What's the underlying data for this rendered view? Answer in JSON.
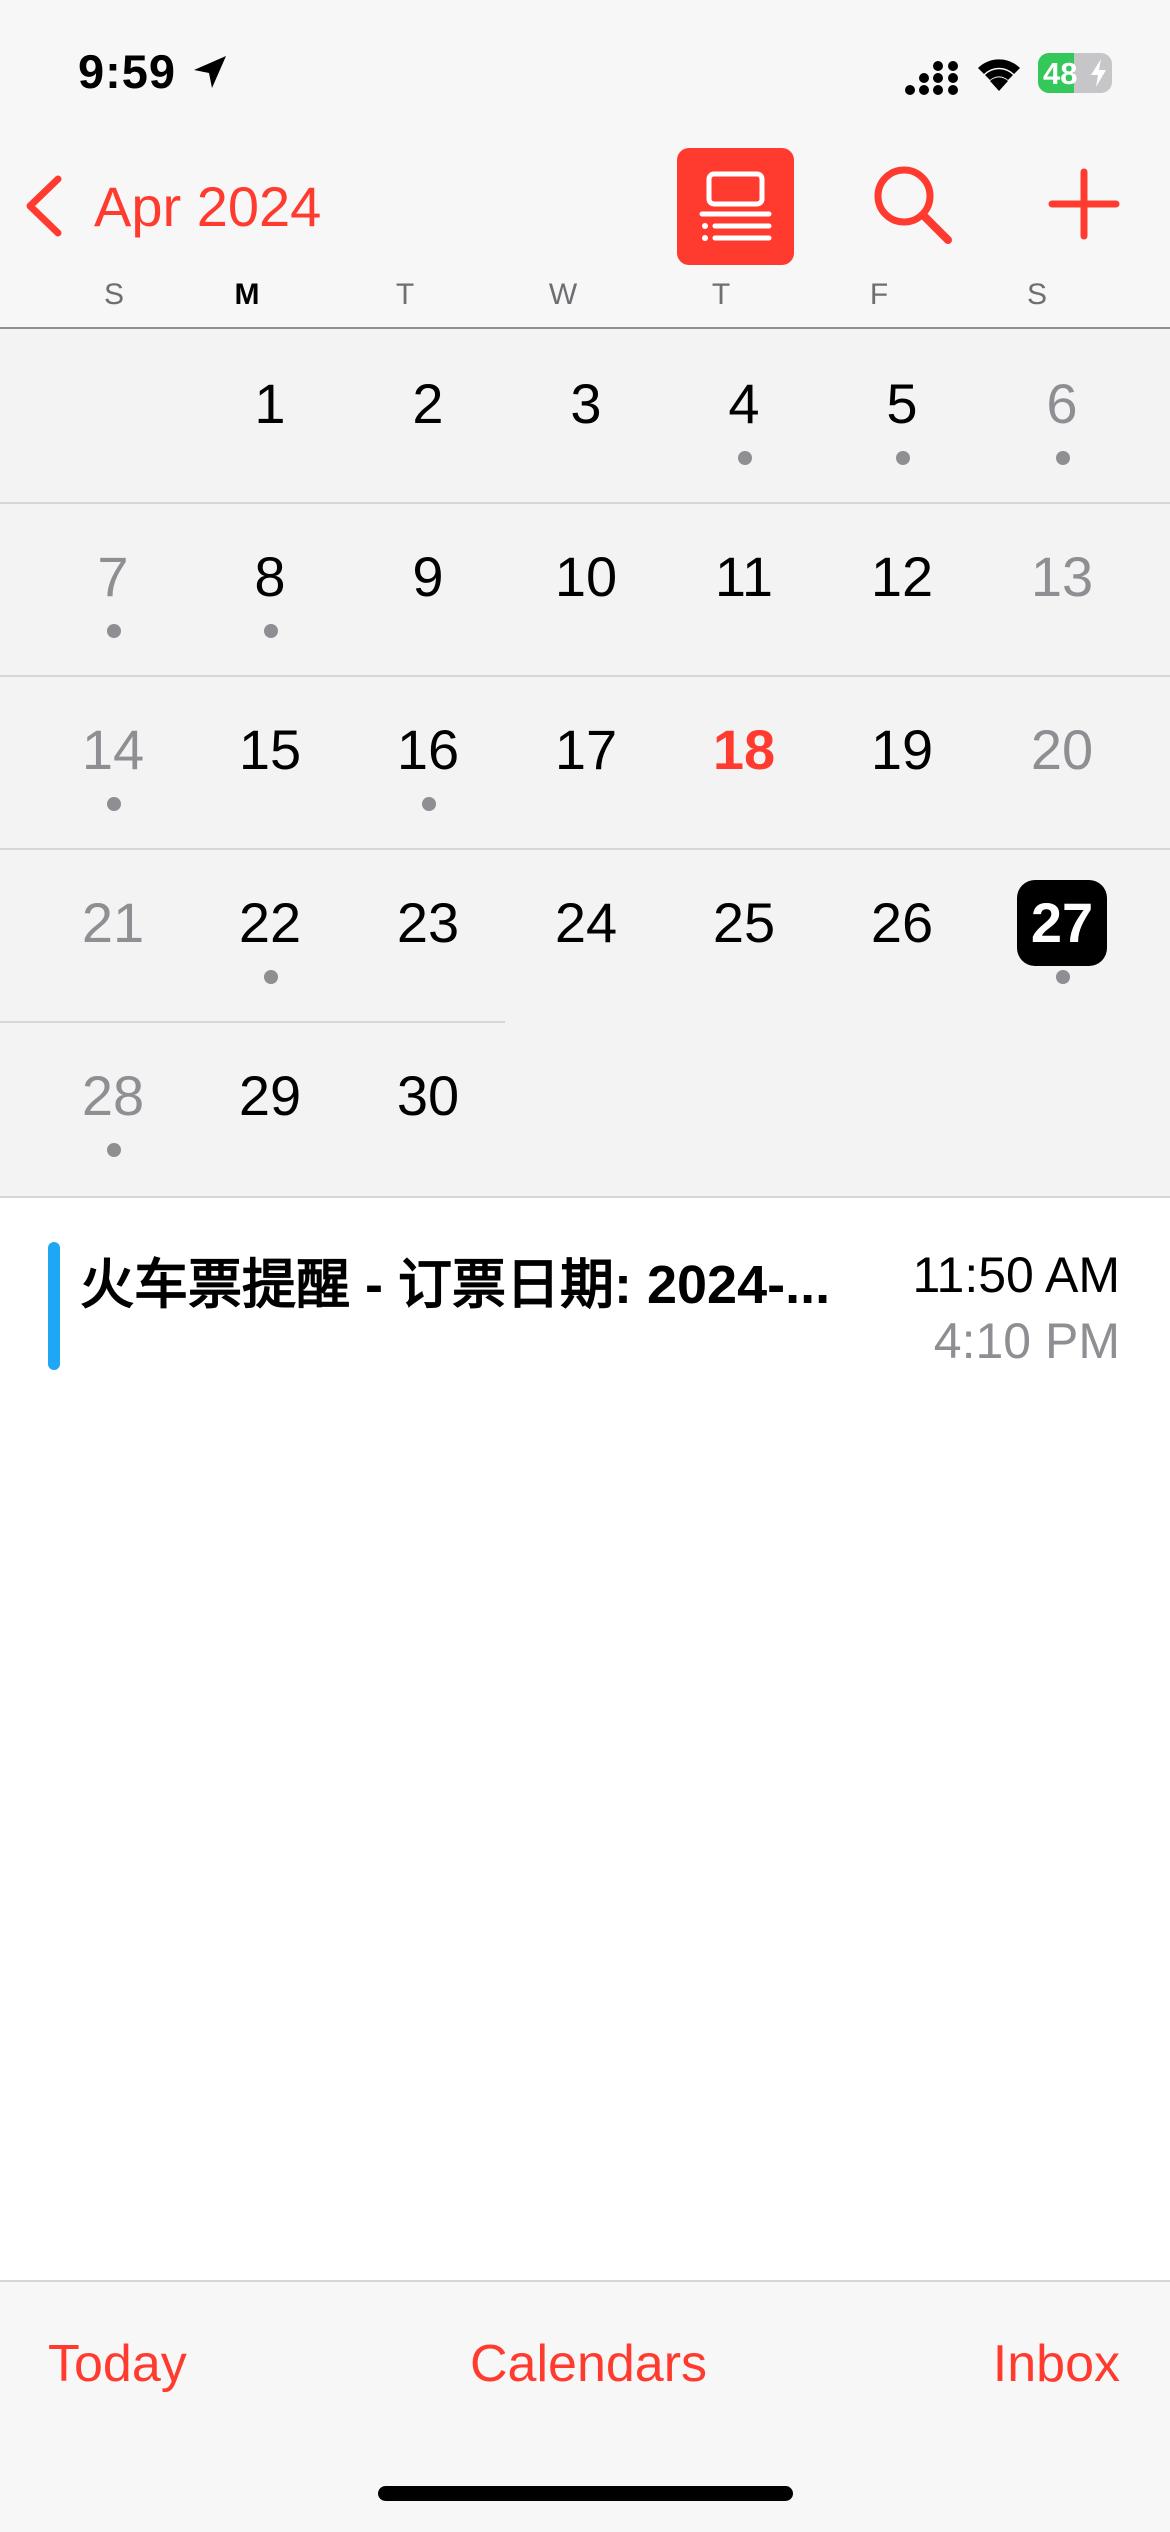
{
  "status_bar": {
    "time": "9:59",
    "battery": "48",
    "battery_level": 0.48,
    "icons": [
      "location-arrow-icon",
      "cellular-signal-icon",
      "wifi-icon",
      "battery-icon",
      "charging-bolt-icon"
    ]
  },
  "header": {
    "back_label": "Apr 2024",
    "icons": [
      "chevron-left-icon",
      "list-view-icon",
      "search-icon",
      "plus-icon"
    ],
    "accent_color": "#ff3b30"
  },
  "weekdays": [
    "S",
    "M",
    "T",
    "W",
    "T",
    "F",
    "S"
  ],
  "calendar": {
    "month": "Apr 2024",
    "today": "18",
    "selected": "27",
    "weeks": [
      [
        {
          "n": "",
          "dot": false
        },
        {
          "n": "1",
          "dot": false
        },
        {
          "n": "2",
          "dot": false
        },
        {
          "n": "3",
          "dot": false
        },
        {
          "n": "4",
          "dot": true
        },
        {
          "n": "5",
          "dot": true
        },
        {
          "n": "6",
          "dot": true
        }
      ],
      [
        {
          "n": "7",
          "dot": true
        },
        {
          "n": "8",
          "dot": true
        },
        {
          "n": "9",
          "dot": false
        },
        {
          "n": "10",
          "dot": false
        },
        {
          "n": "11",
          "dot": false
        },
        {
          "n": "12",
          "dot": false
        },
        {
          "n": "13",
          "dot": false
        }
      ],
      [
        {
          "n": "14",
          "dot": true
        },
        {
          "n": "15",
          "dot": false
        },
        {
          "n": "16",
          "dot": true
        },
        {
          "n": "17",
          "dot": false
        },
        {
          "n": "18",
          "dot": false
        },
        {
          "n": "19",
          "dot": false
        },
        {
          "n": "20",
          "dot": false
        }
      ],
      [
        {
          "n": "21",
          "dot": false
        },
        {
          "n": "22",
          "dot": true
        },
        {
          "n": "23",
          "dot": false
        },
        {
          "n": "24",
          "dot": false
        },
        {
          "n": "25",
          "dot": false
        },
        {
          "n": "26",
          "dot": false
        },
        {
          "n": "27",
          "dot": true
        }
      ],
      [
        {
          "n": "28",
          "dot": true
        },
        {
          "n": "29",
          "dot": false
        },
        {
          "n": "30",
          "dot": false
        }
      ]
    ]
  },
  "events": [
    {
      "title": "火车票提醒 - 订票日期: 2024-...",
      "start": "11:50 AM",
      "end": "4:10 PM",
      "color": "#1ea7f5"
    }
  ],
  "toolbar": {
    "today_label": "Today",
    "calendars_label": "Calendars",
    "inbox_label": "Inbox"
  }
}
